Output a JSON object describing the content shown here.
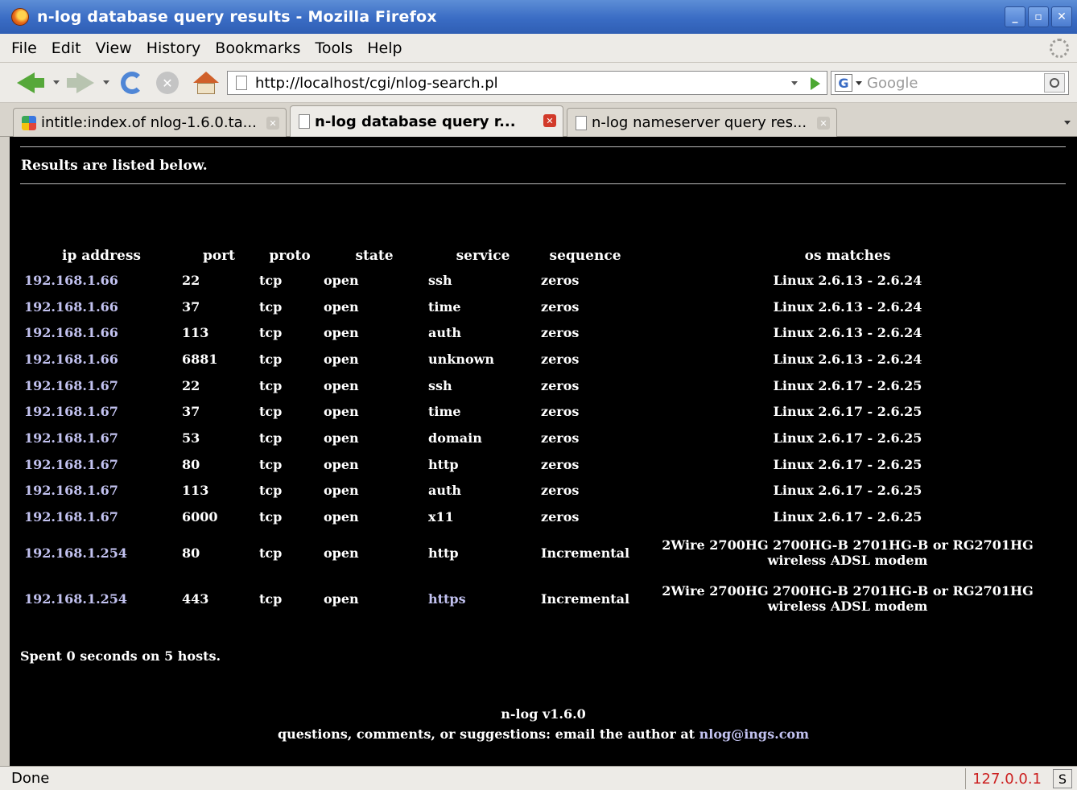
{
  "window": {
    "title": "n-log database query results - Mozilla Firefox",
    "buttons": {
      "minimize": "_",
      "restore": "▫",
      "close": "✕"
    }
  },
  "menu": [
    "File",
    "Edit",
    "View",
    "History",
    "Bookmarks",
    "Tools",
    "Help"
  ],
  "nav": {
    "url": "http://localhost/cgi/nlog-search.pl",
    "search_placeholder": "Google",
    "search_engine_letter": "G",
    "stop_glyph": "✕"
  },
  "tabs": [
    {
      "label": "intitle:index.of nlog-1.6.0.ta...",
      "icon": "google-favicon",
      "active": false
    },
    {
      "label": "n-log database query r...",
      "icon": "page-icon",
      "active": true
    },
    {
      "label": "n-log nameserver query res...",
      "icon": "page-icon",
      "active": false
    }
  ],
  "page": {
    "heading": "Results are listed below.",
    "columns": [
      "ip address",
      "port",
      "proto",
      "state",
      "service",
      "sequence",
      "os matches"
    ],
    "rows": [
      [
        "192.168.1.66",
        "22",
        "tcp",
        "open",
        "ssh",
        "zeros",
        "Linux 2.6.13 - 2.6.24"
      ],
      [
        "192.168.1.66",
        "37",
        "tcp",
        "open",
        "time",
        "zeros",
        "Linux 2.6.13 - 2.6.24"
      ],
      [
        "192.168.1.66",
        "113",
        "tcp",
        "open",
        "auth",
        "zeros",
        "Linux 2.6.13 - 2.6.24"
      ],
      [
        "192.168.1.66",
        "6881",
        "tcp",
        "open",
        "unknown",
        "zeros",
        "Linux 2.6.13 - 2.6.24"
      ],
      [
        "192.168.1.67",
        "22",
        "tcp",
        "open",
        "ssh",
        "zeros",
        "Linux 2.6.17 - 2.6.25"
      ],
      [
        "192.168.1.67",
        "37",
        "tcp",
        "open",
        "time",
        "zeros",
        "Linux 2.6.17 - 2.6.25"
      ],
      [
        "192.168.1.67",
        "53",
        "tcp",
        "open",
        "domain",
        "zeros",
        "Linux 2.6.17 - 2.6.25"
      ],
      [
        "192.168.1.67",
        "80",
        "tcp",
        "open",
        "http",
        "zeros",
        "Linux 2.6.17 - 2.6.25"
      ],
      [
        "192.168.1.67",
        "113",
        "tcp",
        "open",
        "auth",
        "zeros",
        "Linux 2.6.17 - 2.6.25"
      ],
      [
        "192.168.1.67",
        "6000",
        "tcp",
        "open",
        "x11",
        "zeros",
        "Linux 2.6.17 - 2.6.25"
      ],
      [
        "192.168.1.254",
        "80",
        "tcp",
        "open",
        "http",
        "Incremental",
        "2Wire 2700HG 2700HG-B 2701HG-B or RG2701HG wireless ADSL modem"
      ],
      [
        "192.168.1.254",
        "443",
        "tcp",
        "open",
        "https",
        "Incremental",
        "2Wire 2700HG 2700HG-B 2701HG-B or RG2701HG wireless ADSL modem"
      ]
    ],
    "spent": "Spent 0 seconds on 5 hosts.",
    "version": "n-log v1.6.0",
    "contact_prefix": "questions, comments, or suggestions: email the author at ",
    "contact_email": "nlog@ings.com"
  },
  "status": {
    "text": "Done",
    "ip": "127.0.0.1",
    "icon_letter": "S"
  },
  "colors": {
    "link": "#c2c2f0",
    "page_bg": "#000000",
    "title_bar": "#3a6cc4"
  }
}
